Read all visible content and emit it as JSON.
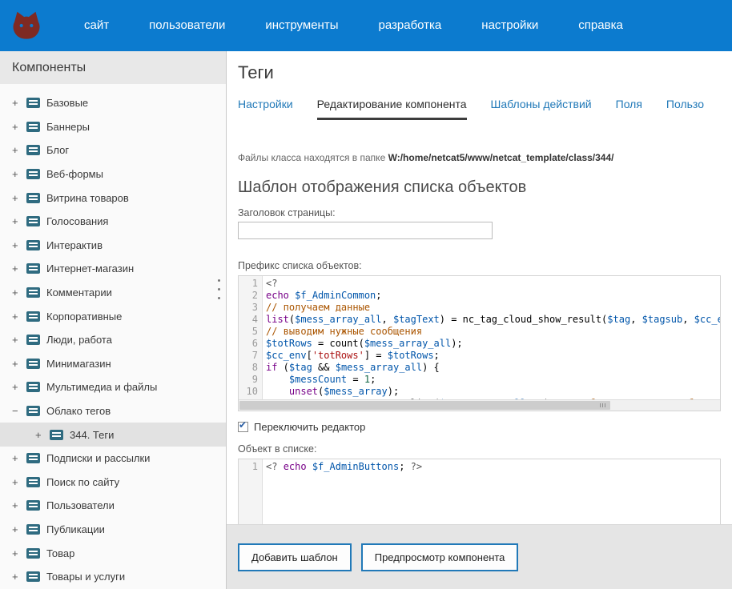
{
  "colors": {
    "topbar": "#0c7bcf",
    "accent": "#2179b8",
    "logo": "#7e2a23",
    "tab-underline": "#3d3d3d"
  },
  "topnav": {
    "items": [
      {
        "label": "сайт"
      },
      {
        "label": "пользователи"
      },
      {
        "label": "инструменты"
      },
      {
        "label": "разработка"
      },
      {
        "label": "настройки"
      },
      {
        "label": "справка"
      }
    ]
  },
  "sidebar": {
    "title": "Компоненты",
    "items": [
      {
        "label": "Базовые",
        "expander": "+",
        "level": 0,
        "selected": false
      },
      {
        "label": "Баннеры",
        "expander": "+",
        "level": 0,
        "selected": false
      },
      {
        "label": "Блог",
        "expander": "+",
        "level": 0,
        "selected": false
      },
      {
        "label": "Веб-формы",
        "expander": "+",
        "level": 0,
        "selected": false
      },
      {
        "label": "Витрина товаров",
        "expander": "+",
        "level": 0,
        "selected": false
      },
      {
        "label": "Голосования",
        "expander": "+",
        "level": 0,
        "selected": false
      },
      {
        "label": "Интерактив",
        "expander": "+",
        "level": 0,
        "selected": false
      },
      {
        "label": "Интернет-магазин",
        "expander": "+",
        "level": 0,
        "selected": false
      },
      {
        "label": "Комментарии",
        "expander": "+",
        "level": 0,
        "selected": false
      },
      {
        "label": "Корпоративные",
        "expander": "+",
        "level": 0,
        "selected": false
      },
      {
        "label": "Люди, работа",
        "expander": "+",
        "level": 0,
        "selected": false
      },
      {
        "label": "Минимагазин",
        "expander": "+",
        "level": 0,
        "selected": false
      },
      {
        "label": "Мультимедиа и файлы",
        "expander": "+",
        "level": 0,
        "selected": false
      },
      {
        "label": "Облако тегов",
        "expander": "−",
        "level": 0,
        "selected": false
      },
      {
        "label": "344. Теги",
        "expander": "+",
        "level": 1,
        "selected": true
      },
      {
        "label": "Подписки и рассылки",
        "expander": "+",
        "level": 0,
        "selected": false
      },
      {
        "label": "Поиск по сайту",
        "expander": "+",
        "level": 0,
        "selected": false
      },
      {
        "label": "Пользователи",
        "expander": "+",
        "level": 0,
        "selected": false
      },
      {
        "label": "Публикации",
        "expander": "+",
        "level": 0,
        "selected": false
      },
      {
        "label": "Товар",
        "expander": "+",
        "level": 0,
        "selected": false
      },
      {
        "label": "Товары и услуги",
        "expander": "+",
        "level": 0,
        "selected": false
      }
    ]
  },
  "main": {
    "title": "Теги",
    "tabs": [
      {
        "label": "Настройки",
        "active": false
      },
      {
        "label": "Редактирование компонента",
        "active": true
      },
      {
        "label": "Шаблоны действий",
        "active": false
      },
      {
        "label": "Поля",
        "active": false
      },
      {
        "label": "Пользо",
        "active": false
      }
    ],
    "class_path_prefix": "Файлы класса находятся в папке",
    "class_path": "W:/home/netcat5/www/netcat_template/class/344/",
    "section_heading": "Шаблон отображения списка объектов",
    "page_title_label": "Заголовок страницы:",
    "page_title_value": "",
    "prefix_label": "Префикс списка объектов:",
    "toggle_editor_label": "Переключить редактор",
    "toggle_editor_checked": true,
    "object_label": "Объект в списке:"
  },
  "editors": {
    "prefix": {
      "lines": [
        [
          {
            "c": "meta",
            "t": "<?"
          }
        ],
        [
          {
            "c": "kw",
            "t": "echo"
          },
          {
            "c": "",
            "t": " "
          },
          {
            "c": "var",
            "t": "$f_AdminCommon"
          },
          {
            "c": "",
            "t": ";"
          }
        ],
        [
          {
            "c": "com",
            "t": "// получаем данные"
          }
        ],
        [
          {
            "c": "kw",
            "t": "list"
          },
          {
            "c": "",
            "t": "("
          },
          {
            "c": "var",
            "t": "$mess_array_all"
          },
          {
            "c": "",
            "t": ", "
          },
          {
            "c": "var",
            "t": "$tagText"
          },
          {
            "c": "",
            "t": ") = nc_tag_cloud_show_result("
          },
          {
            "c": "var",
            "t": "$tag"
          },
          {
            "c": "",
            "t": ", "
          },
          {
            "c": "var",
            "t": "$tagsub"
          },
          {
            "c": "",
            "t": ", "
          },
          {
            "c": "var",
            "t": "$cc_env"
          },
          {
            "c": "",
            "t": ");"
          }
        ],
        [
          {
            "c": "com",
            "t": "// выводим нужные сообщения"
          }
        ],
        [
          {
            "c": "var",
            "t": "$totRows"
          },
          {
            "c": "",
            "t": " = count("
          },
          {
            "c": "var",
            "t": "$mess_array_all"
          },
          {
            "c": "",
            "t": ");"
          }
        ],
        [
          {
            "c": "var",
            "t": "$cc_env"
          },
          {
            "c": "",
            "t": "["
          },
          {
            "c": "str",
            "t": "'totRows'"
          },
          {
            "c": "",
            "t": "] = "
          },
          {
            "c": "var",
            "t": "$totRows"
          },
          {
            "c": "",
            "t": ";"
          }
        ],
        [
          {
            "c": "kw",
            "t": "if"
          },
          {
            "c": "",
            "t": " ("
          },
          {
            "c": "var",
            "t": "$tag"
          },
          {
            "c": "",
            "t": " && "
          },
          {
            "c": "var",
            "t": "$mess_array_all"
          },
          {
            "c": "",
            "t": ") {"
          }
        ],
        [
          {
            "c": "",
            "t": "    "
          },
          {
            "c": "var",
            "t": "$messCount"
          },
          {
            "c": "",
            "t": " = "
          },
          {
            "c": "num",
            "t": "1"
          },
          {
            "c": "",
            "t": ";"
          }
        ],
        [
          {
            "c": "",
            "t": "    "
          },
          {
            "c": "kw",
            "t": "unset"
          },
          {
            "c": "",
            "t": "("
          },
          {
            "c": "var",
            "t": "$mess_array"
          },
          {
            "c": "",
            "t": ");"
          }
        ],
        [
          {
            "c": "",
            "t": "    "
          },
          {
            "c": "var",
            "t": "$mess_array"
          },
          {
            "c": "",
            "t": " = array_slice("
          },
          {
            "c": "var",
            "t": "$mess_array_all"
          },
          {
            "c": "",
            "t": ", "
          },
          {
            "c": "num",
            "t": "0"
          },
          {
            "c": "",
            "t": "); "
          },
          {
            "c": "com",
            "t": "// отбираем нужные сообщения"
          }
        ]
      ]
    },
    "object": {
      "lines": [
        [
          {
            "c": "meta",
            "t": "<?"
          },
          {
            "c": "",
            "t": " "
          },
          {
            "c": "kw",
            "t": "echo"
          },
          {
            "c": "",
            "t": " "
          },
          {
            "c": "var",
            "t": "$f_AdminButtons"
          },
          {
            "c": "",
            "t": "; "
          },
          {
            "c": "meta",
            "t": "?>"
          }
        ]
      ]
    }
  },
  "footer": {
    "buttons": [
      {
        "label": "Добавить шаблон",
        "name": "add-template-button"
      },
      {
        "label": "Предпросмотр компонента",
        "name": "preview-component-button"
      }
    ]
  }
}
